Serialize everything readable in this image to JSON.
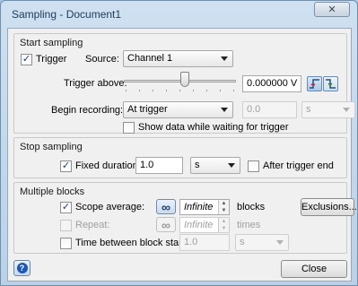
{
  "window": {
    "title": "Sampling - Document1",
    "close_glyph": "✕"
  },
  "start_sampling": {
    "legend": "Start sampling",
    "trigger_checked": true,
    "trigger_label": "Trigger",
    "source_label": "Source:",
    "source_value": "Channel 1",
    "trigger_above_label": "Trigger above:",
    "slider_position_fraction": 0.55,
    "threshold_value": "0.000000 V",
    "begin_recording_label": "Begin recording:",
    "begin_recording_value": "At trigger",
    "pretrigger_value": "0.0",
    "pretrigger_unit": "s",
    "show_data_checked": false,
    "show_data_label": "Show data while waiting for trigger"
  },
  "stop_sampling": {
    "legend": "Stop sampling",
    "fixed_duration_checked": true,
    "fixed_duration_label": "Fixed duration:",
    "duration_value": "1.0",
    "duration_unit": "s",
    "after_trigger_end_checked": false,
    "after_trigger_end_label": "After trigger end"
  },
  "multiple_blocks": {
    "legend": "Multiple blocks",
    "scope_average_checked": true,
    "scope_average_label": "Scope average:",
    "infinity_glyph": "∞",
    "scope_average_value": "Infinite",
    "scope_average_unit": "blocks",
    "exclusions_label": "Exclusions...",
    "repeat_checked": false,
    "repeat_label": "Repeat:",
    "repeat_value": "Infinite",
    "repeat_unit": "times",
    "time_between_checked": false,
    "time_between_label": "Time between block starts:",
    "time_between_value": "1.0",
    "time_between_unit": "s"
  },
  "footer": {
    "help_glyph": "?",
    "close_label": "Close"
  }
}
